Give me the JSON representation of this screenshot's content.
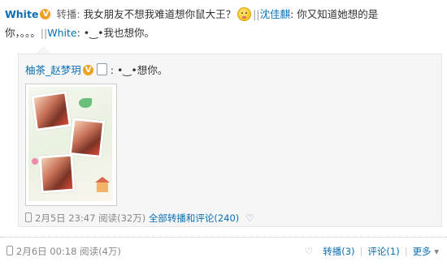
{
  "post": {
    "author": "White",
    "repost_label": "转播:",
    "text1": "我女朋友不想我难道想你鼠大王？",
    "emoji": "smile-emoji",
    "sep1": "||",
    "reply_author": "沈佳麒",
    "text2": ": 你又知道她想的是",
    "text3": "你，。。。",
    "sep2": "||",
    "reply2_author": "White",
    "text4": ": •‿•我也想你。"
  },
  "quote": {
    "author": "柚茶_赵梦玥",
    "text": ": •‿•想你。",
    "meta_date": "2月5日 23:47",
    "meta_reads": "阅读(32万)",
    "meta_link": "全部转播和评论(240)"
  },
  "footer": {
    "date": "2月6日 00:18",
    "reads": "阅读(4万)",
    "repost": "转播(3)",
    "comment": "评论(1)",
    "more": "更多"
  }
}
